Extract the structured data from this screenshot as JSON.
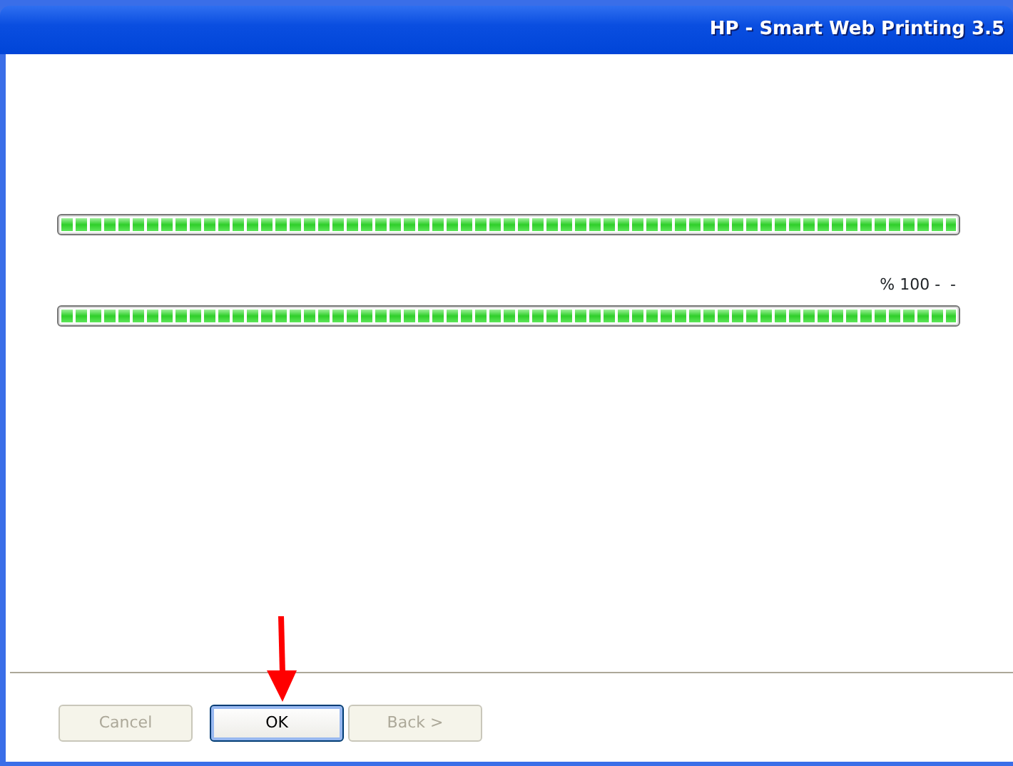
{
  "window": {
    "title": "HP - Smart Web Printing 3.5"
  },
  "progress_bars": [
    {
      "level": 1.0
    },
    {
      "level": 1.0
    }
  ],
  "progress_label": "% 100 -  -",
  "annotation": {
    "kind": "arrow"
  },
  "buttons": [
    {
      "label": "Cancel",
      "disabled": true,
      "default": false
    },
    {
      "label": "OK",
      "disabled": false,
      "default": true
    },
    {
      "label": "Back >",
      "disabled": true,
      "default": false
    }
  ]
}
